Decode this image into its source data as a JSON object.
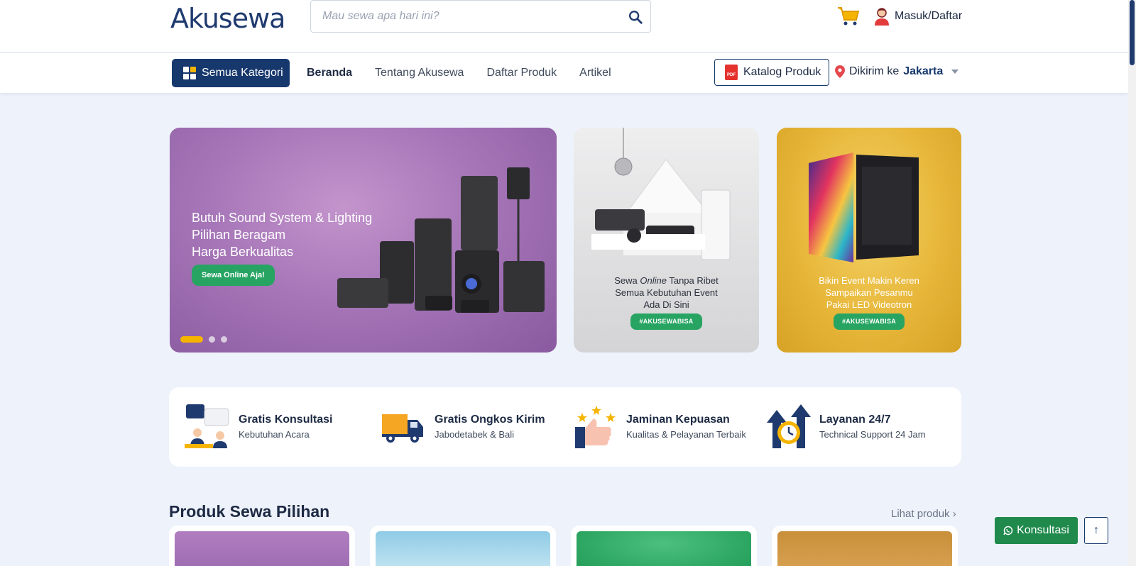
{
  "header": {
    "logo_text": "Akusewa",
    "search_placeholder": "Mau sewa apa hari ini?",
    "login_label": "Masuk/Daftar"
  },
  "nav": {
    "category_label": "Semua Kategori",
    "links": [
      "Beranda",
      "Tentang Akusewa",
      "Daftar Produk",
      "Artikel"
    ],
    "active_link": "Beranda",
    "katalog_label": "Katalog Produk",
    "pdf_label": "PDF",
    "ship_prefix": "Dikirim ke",
    "ship_city": "Jakarta"
  },
  "banners": {
    "main": {
      "line1": "Butuh Sound System & Lighting",
      "line2": "Pilihan Beragam",
      "line3": "Harga Berkualitas",
      "cta": "Sewa Online Aja!"
    },
    "second": {
      "line1_pre": "Sewa ",
      "line1_em": "Online",
      "line1_post": " Tanpa Ribet",
      "line2": "Semua Kebutuhan Event",
      "line3": "Ada Di Sini",
      "tag": "#AKUSEWABISA"
    },
    "third": {
      "line1": "Bikin Event Makin Keren",
      "line2": "Sampaikan Pesanmu",
      "line3": "Pakai LED Videotron",
      "tag": "#AKUSEWABISA"
    },
    "slide_count": 3,
    "active_slide": 1
  },
  "features": [
    {
      "title": "Gratis Konsultasi",
      "subtitle": "Kebutuhan Acara",
      "icon": "chat-consultation-icon"
    },
    {
      "title": "Gratis Ongkos Kirim",
      "subtitle": "Jabodetabek & Bali",
      "icon": "delivery-truck-icon"
    },
    {
      "title": "Jaminan Kepuasan",
      "subtitle": "Kualitas & Pelayanan Terbaik",
      "icon": "thumbs-up-stars-icon"
    },
    {
      "title": "Layanan 24/7",
      "subtitle": "Technical Support 24 Jam",
      "icon": "clock-arrows-icon"
    }
  ],
  "products": {
    "title": "Produk Sewa Pilihan",
    "see_all": "Lihat produk ›"
  },
  "floating": {
    "whatsapp_label": "Konsultasi",
    "up_label": "↑"
  },
  "colors": {
    "brand_navy": "#17386d",
    "accent_yellow": "#f5b400",
    "green": "#27a462",
    "page_bg": "#eef2fb"
  }
}
